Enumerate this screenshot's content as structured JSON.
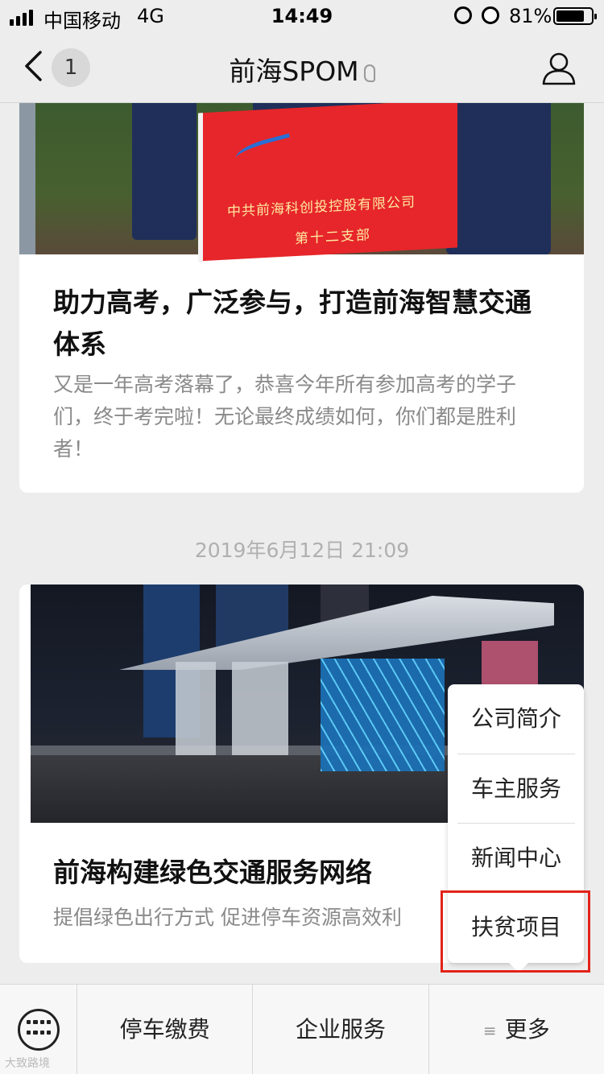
{
  "status_bar": {
    "carrier": "中国移动",
    "network": "4G",
    "time": "14:49",
    "battery_percent": "81%",
    "battery_level": 0.81
  },
  "nav": {
    "back_badge": "1",
    "title": "前海SPOM"
  },
  "articles": [
    {
      "banner_line1": "中共前海科创投控股有限公司",
      "banner_line2": "第十二支部",
      "headline": "助力高考，广泛参与，打造前海智慧交通体系",
      "summary": "又是一年高考落幕了，恭喜今年所有参加高考的学子们，终于考完啦！无论最终成绩如何，你们都是胜利者！"
    },
    {
      "headline": "前海构建绿色交通服务网络",
      "summary": "提倡绿色出行方式 促进停车资源高效利"
    }
  ],
  "timestamp": "2019年6月12日 21:09",
  "popup_menu": {
    "items": [
      "公司简介",
      "车主服务",
      "新闻中心",
      "扶贫项目"
    ],
    "highlight_color": "#e2231a"
  },
  "bottom_bar": {
    "tabs": [
      "停车缴费",
      "企业服务",
      "更多"
    ],
    "more_prefix": "≡"
  },
  "watermark": "大致路境"
}
